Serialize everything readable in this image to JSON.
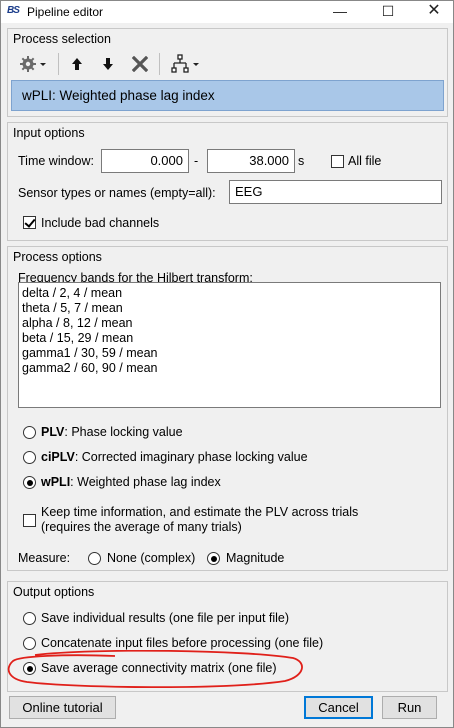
{
  "window": {
    "title": "Pipeline editor",
    "app_icon_text": "BS",
    "minimize": "—",
    "maximize": "☐",
    "close": "✕"
  },
  "process_selection": {
    "group_title": "Process selection",
    "selected_process": "wPLI: Weighted phase lag index"
  },
  "input_options": {
    "group_title": "Input options",
    "time_window_label": "Time window:",
    "time_start": "0.000",
    "dash": "-",
    "time_end": "38.000",
    "unit": "s",
    "all_file_label": "All file",
    "all_file_checked": false,
    "sensor_label": "Sensor types or names (empty=all):",
    "sensor_value": "EEG",
    "include_bad_label": "Include bad channels",
    "include_bad_checked": true
  },
  "process_options": {
    "group_title": "Process options",
    "freq_label": "Frequency bands for the Hilbert transform:",
    "freq_bands": [
      "delta / 2, 4 / mean",
      "theta / 5, 7 / mean",
      "alpha / 8, 12 / mean",
      "beta / 15, 29 / mean",
      "gamma1 / 30, 59 / mean",
      "gamma2 / 60, 90 / mean"
    ],
    "methods": [
      {
        "bold": "PLV",
        "rest": ": Phase locking value",
        "checked": false
      },
      {
        "bold": "ciPLV",
        "rest": ": Corrected imaginary phase locking value",
        "checked": false
      },
      {
        "bold": "wPLI",
        "rest": ": Weighted phase lag index",
        "checked": true
      }
    ],
    "keep_time_line1": "Keep time information, and estimate the PLV across trials",
    "keep_time_line2": "(requires the average of many trials)",
    "keep_time_checked": false,
    "measure_label": "Measure:",
    "measure_none": "None (complex)",
    "measure_magnitude": "Magnitude",
    "measure_selected": "Magnitude"
  },
  "output_options": {
    "group_title": "Output options",
    "options": [
      "Save individual results (one file per input file)",
      "Concatenate input files before processing (one file)",
      "Save average connectivity matrix (one file)"
    ],
    "selected_index": 2
  },
  "buttons": {
    "online_tutorial": "Online tutorial",
    "cancel": "Cancel",
    "run": "Run"
  },
  "colors": {
    "selection_bg": "#a9c7e8",
    "annotation_red": "#e0201a",
    "default_button_border": "#0078d7"
  }
}
